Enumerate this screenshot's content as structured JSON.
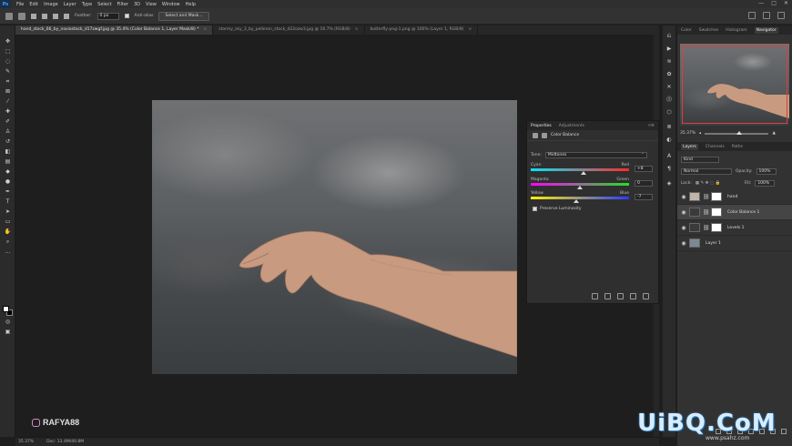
{
  "menubar": {
    "logo": "Ps",
    "items": [
      "File",
      "Edit",
      "Image",
      "Layer",
      "Type",
      "Select",
      "Filter",
      "3D",
      "View",
      "Window",
      "Help"
    ],
    "controls": [
      "—",
      "□",
      "✕"
    ]
  },
  "options": {
    "feather_label": "Feather:",
    "feather_value": "0 px",
    "antialias_label": "Anti-alias",
    "select_mask_button": "Select and Mask..."
  },
  "doc_tabs": [
    {
      "label": "hand_stock_66_by_noxiostock_d17zwgf.jpg @ 35.4% (Color Balance 1, Layer Mask/8) *",
      "active": true
    },
    {
      "label": "stormy_sky_3_by_pelleron_stock_d22ozw3.jpg @ 16.7% (RGB/8)",
      "active": false
    },
    {
      "label": "butterfly-png-1.png @ 100% (Layer 1, RGB/8)",
      "active": false
    }
  ],
  "statusbar": {
    "zoom": "35.37%",
    "doc": "Doc: 13.4M/40.8M"
  },
  "watermark": {
    "text": "RAFYA88"
  },
  "properties": {
    "tabs": [
      "Properties",
      "Adjustments"
    ],
    "title": "Color Balance",
    "tone_label": "Tone:",
    "tone_value": "Midtones",
    "sliders": [
      {
        "left": "Cyan",
        "right": "Red",
        "value": "+8",
        "position": 0.54,
        "colors": [
          "#00e5ff",
          "#ff2a2a"
        ]
      },
      {
        "left": "Magenta",
        "right": "Green",
        "value": "0",
        "position": 0.5,
        "colors": [
          "#ff00ff",
          "#22e022"
        ]
      },
      {
        "left": "Yellow",
        "right": "Blue",
        "value": "-7",
        "position": 0.46,
        "colors": [
          "#ffee00",
          "#2a3cff"
        ]
      }
    ],
    "preserve_label": "Preserve Luminosity"
  },
  "right_panel": {
    "top_tabs": [
      "Color",
      "Swatches",
      "Histogram",
      "Navigator"
    ],
    "zoom": "35.37%",
    "layer_tabs": [
      "Layers",
      "Channels",
      "Paths"
    ],
    "kind": "Kind",
    "blend_mode": "Normal",
    "opacity_label": "Opacity:",
    "opacity_value": "100%",
    "lock_label": "Lock:",
    "fill_label": "Fill:",
    "fill_value": "100%",
    "layers": [
      {
        "name": "hand",
        "thumb": "#bfb5a8",
        "mask": true,
        "selected": false,
        "chain": true
      },
      {
        "name": "Color Balance 1",
        "thumb": "#3a3a3a",
        "mask": true,
        "selected": true,
        "chain": true
      },
      {
        "name": "Levels 1",
        "thumb": "#3a3a3a",
        "mask": true,
        "selected": false,
        "chain": true
      },
      {
        "name": "Layer 1",
        "thumb": "#7d8894",
        "mask": false,
        "selected": false,
        "chain": false
      }
    ]
  },
  "site_watermark": {
    "main": "UiBQ.CoM",
    "sub": "www.psahz.com"
  }
}
